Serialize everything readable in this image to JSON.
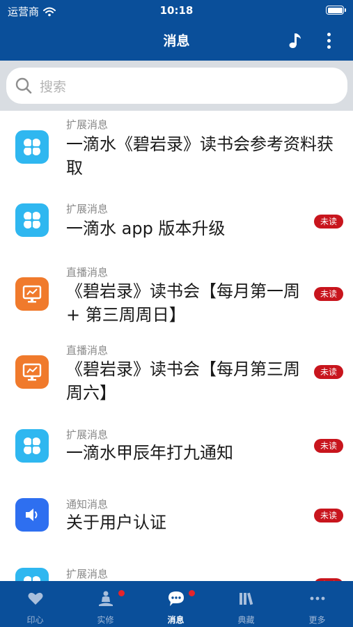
{
  "status_bar": {
    "carrier": "运营商",
    "time": "10:18"
  },
  "nav": {
    "title": "消息"
  },
  "search": {
    "placeholder": "搜索"
  },
  "messages": [
    {
      "category": "扩展消息",
      "title": "一滴水《碧岩录》读书会参考资料获取",
      "icon": "clover-app-icon",
      "unread": false
    },
    {
      "category": "扩展消息",
      "title": "一滴水 app 版本升级",
      "icon": "clover-app-icon",
      "unread": true
    },
    {
      "category": "直播消息",
      "title": "《碧岩录》读书会【每月第一周 + 第三周周日】",
      "icon": "live-monitor-icon",
      "unread": true
    },
    {
      "category": "直播消息",
      "title": "《碧岩录》读书会【每月第三周周六】",
      "icon": "live-monitor-icon",
      "unread": true
    },
    {
      "category": "扩展消息",
      "title": "一滴水甲辰年打九通知",
      "icon": "clover-app-icon",
      "unread": true
    },
    {
      "category": "通知消息",
      "title": "关于用户认证",
      "icon": "speaker-icon",
      "unread": true
    },
    {
      "category": "扩展消息",
      "title": "",
      "icon": "clover-app-icon",
      "unread": true
    }
  ],
  "unread_label": "未读",
  "tabs": [
    {
      "label": "印心",
      "icon": "heart-icon",
      "active": false,
      "dot": false
    },
    {
      "label": "实修",
      "icon": "meditation-icon",
      "active": false,
      "dot": true
    },
    {
      "label": "消息",
      "icon": "chat-bubble-icon",
      "active": true,
      "dot": true
    },
    {
      "label": "典藏",
      "icon": "library-icon",
      "active": false,
      "dot": false
    },
    {
      "label": "更多",
      "icon": "more-dots-icon",
      "active": false,
      "dot": false
    }
  ],
  "colors": {
    "primary": "#0a4f9a",
    "unread_badge": "#c8151d",
    "clover_app": "#2fb7f0",
    "live_app": "#f07a2c",
    "notice_app": "#2e6ff0"
  }
}
